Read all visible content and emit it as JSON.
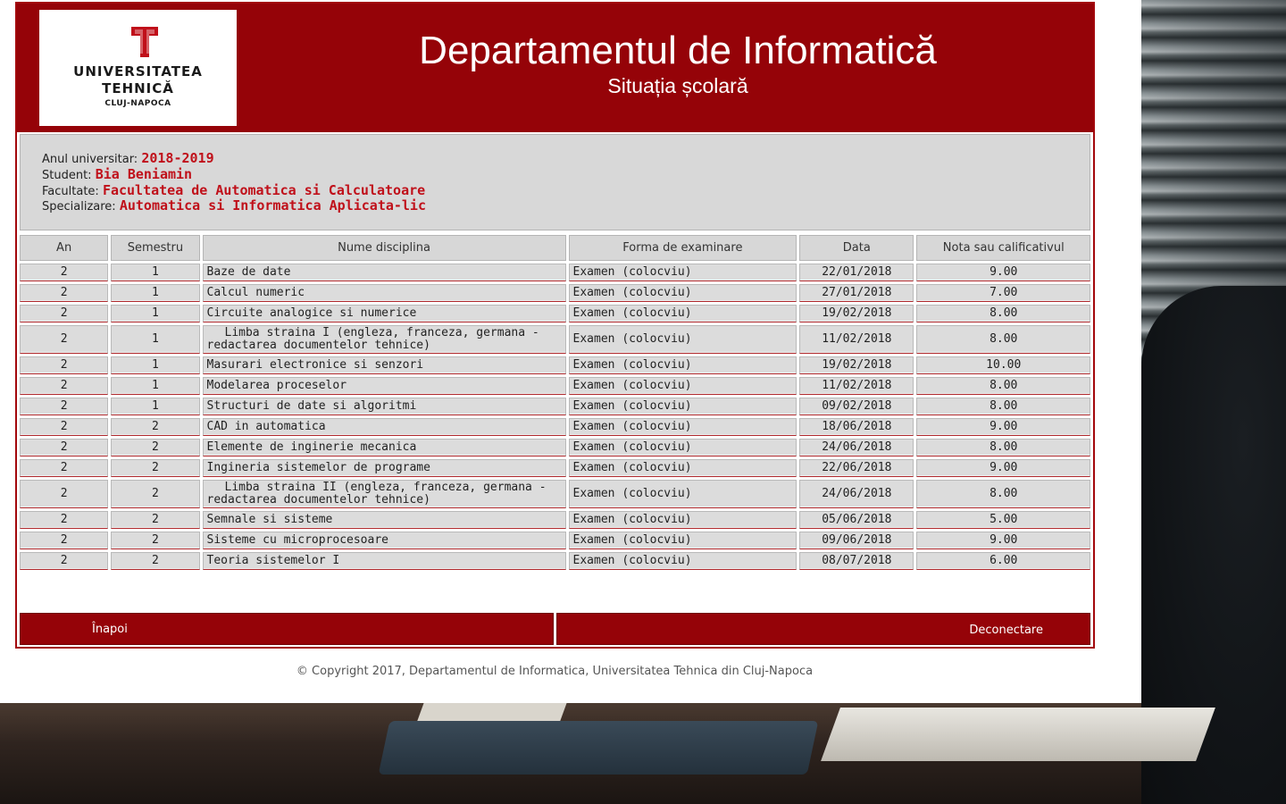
{
  "header": {
    "logo_lines": [
      "UNIVERSITATEA",
      "TEHNICĂ",
      "CLUJ-NAPOCA"
    ],
    "title": "Departamentul de Informatică",
    "subtitle": "Situația școlară"
  },
  "info": {
    "year_label": "Anul universitar:",
    "year_value": "2018-2019",
    "student_label": "Student:",
    "student_value": "Bia Beniamin",
    "faculty_label": "Facultate:",
    "faculty_value": "Facultatea de Automatica si Calculatoare",
    "spec_label": "Specializare:",
    "spec_value": "Automatica si Informatica Aplicata-lic"
  },
  "table": {
    "headers": [
      "An",
      "Semestru",
      "Nume disciplina",
      "Forma de examinare",
      "Data",
      "Nota sau calificativul"
    ],
    "rows": [
      [
        "2",
        "1",
        "Baze de date",
        "Examen (colocviu)",
        "22/01/2018",
        "9.00"
      ],
      [
        "2",
        "1",
        "Calcul numeric",
        "Examen (colocviu)",
        "27/01/2018",
        "7.00"
      ],
      [
        "2",
        "1",
        "Circuite analogice si numerice",
        "Examen (colocviu)",
        "19/02/2018",
        "8.00"
      ],
      [
        "2",
        "1",
        "Limba straina I (engleza, franceza, germana - redactarea documentelor tehnice)",
        "Examen (colocviu)",
        "11/02/2018",
        "8.00"
      ],
      [
        "2",
        "1",
        "Masurari electronice si senzori",
        "Examen (colocviu)",
        "19/02/2018",
        "10.00"
      ],
      [
        "2",
        "1",
        "Modelarea proceselor",
        "Examen (colocviu)",
        "11/02/2018",
        "8.00"
      ],
      [
        "2",
        "1",
        "Structuri de date si algoritmi",
        "Examen (colocviu)",
        "09/02/2018",
        "8.00"
      ],
      [
        "2",
        "2",
        "CAD in automatica",
        "Examen (colocviu)",
        "18/06/2018",
        "9.00"
      ],
      [
        "2",
        "2",
        "Elemente de inginerie mecanica",
        "Examen (colocviu)",
        "24/06/2018",
        "8.00"
      ],
      [
        "2",
        "2",
        "Ingineria sistemelor de programe",
        "Examen (colocviu)",
        "22/06/2018",
        "9.00"
      ],
      [
        "2",
        "2",
        "Limba straina II (engleza, franceza, germana - redactarea documentelor tehnice)",
        "Examen (colocviu)",
        "24/06/2018",
        "8.00"
      ],
      [
        "2",
        "2",
        "Semnale si sisteme",
        "Examen (colocviu)",
        "05/06/2018",
        "5.00"
      ],
      [
        "2",
        "2",
        "Sisteme cu microprocesoare",
        "Examen (colocviu)",
        "09/06/2018",
        "9.00"
      ],
      [
        "2",
        "2",
        "Teoria sistemelor I",
        "Examen (colocviu)",
        "08/07/2018",
        "6.00"
      ]
    ]
  },
  "nav": {
    "back_label": "Înapoi",
    "logout_label": "Deconectare"
  },
  "footer": {
    "copyright": "© Copyright 2017, Departamentul de Informatica, Universitatea Tehnica din Cluj-Napoca"
  },
  "colors": {
    "brand_red": "#950308",
    "value_red": "#c0101a",
    "panel_gray": "#d8d8d8"
  }
}
